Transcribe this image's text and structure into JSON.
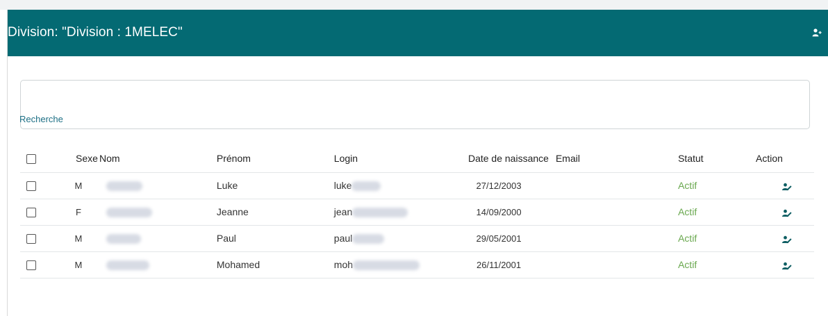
{
  "header": {
    "division_label": "Division: ",
    "division_value": "\"Division : 1MELEC\""
  },
  "search": {
    "label": "Recherche",
    "placeholder": ""
  },
  "table": {
    "columns": {
      "sexe": "Sexe",
      "nom": "Nom",
      "prenom": "Prénom",
      "login": "Login",
      "date": "Date de naissance",
      "email": "Email",
      "statut": "Statut",
      "action": "Action"
    },
    "rows": [
      {
        "sexe": "M",
        "prenom": "Luke",
        "login_prefix": "luke",
        "date": "27/12/2003",
        "statut": "Actif"
      },
      {
        "sexe": "F",
        "prenom": "Jeanne",
        "login_prefix": "jean",
        "date": "14/09/2000",
        "statut": "Actif"
      },
      {
        "sexe": "M",
        "prenom": "Paul",
        "login_prefix": "paul",
        "date": "29/05/2001",
        "statut": "Actif"
      },
      {
        "sexe": "M",
        "prenom": "Mohamed",
        "login_prefix": "moh",
        "date": "26/11/2001",
        "statut": "Actif"
      }
    ]
  },
  "colors": {
    "header_bg": "#046a73",
    "status_active": "#6aa84f",
    "search_label": "#1d6f85",
    "action_icon": "#0e5e63"
  },
  "icons": {
    "header": "user-plus-icon",
    "row_action": "user-edit-icon"
  }
}
